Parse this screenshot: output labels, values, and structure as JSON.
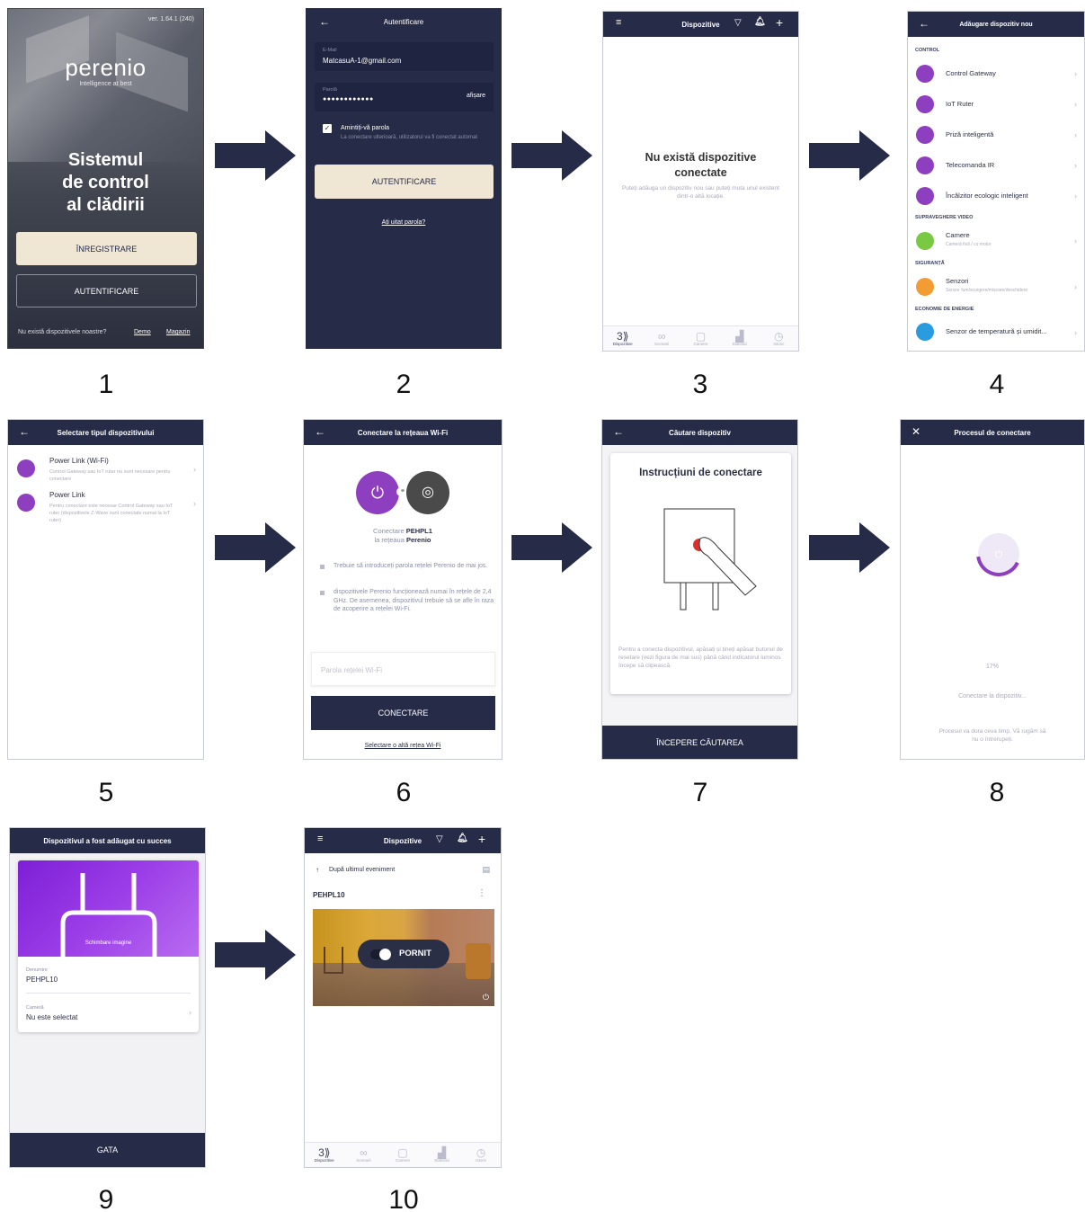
{
  "step_numbers": [
    "1",
    "2",
    "3",
    "4",
    "5",
    "6",
    "7",
    "8",
    "9",
    "10"
  ],
  "colors": {
    "navy": "#262b47",
    "purple": "#8e3fbf",
    "cream": "#efe6d3"
  },
  "s1": {
    "version": "ver. 1.64.1 (240)",
    "logo": "perenio",
    "tagline": "Intelligence at best",
    "headline": [
      "Sistemul",
      "de control",
      "al clădirii"
    ],
    "register": "ÎNREGISTRARE",
    "login": "AUTENTIFICARE",
    "footer_question": "Nu există dispozitivele noastre?",
    "demo": "Demo",
    "shop": "Magazin"
  },
  "s2": {
    "title": "Autentificare",
    "email_label": "E-Mail",
    "email_value": "MatcasuA-1@gmail.com",
    "password_label": "Parolă",
    "password_value": "●●●●●●●●●●●●",
    "show": "afișare",
    "remember": "Amintiți-vă parola",
    "remember_hint": "La conectare ulterioară, utilizatorul va fi conectat automat",
    "login_button": "AUTENTIFICARE",
    "forgot": "Ați uitat parola?"
  },
  "s3": {
    "title": "Dispozitive",
    "empty_title": "Nu există dispozitive conectate",
    "empty_hint": "Puteți adăuga un dispozitiv nou sau puteți muta unul existent dintr-o altă locație."
  },
  "tabs": [
    "Dispozitive",
    "Scenarii",
    "Camere",
    "Statistici",
    "Istoric"
  ],
  "s4": {
    "title": "Adăugare dispozitiv nou",
    "sections": [
      {
        "name": "CONTROL",
        "items": [
          {
            "label": "Control Gateway",
            "sub": ""
          },
          {
            "label": "IoT Ruter",
            "sub": ""
          },
          {
            "label": "Priză inteligentă",
            "sub": ""
          },
          {
            "label": "Telecomanda IR",
            "sub": ""
          },
          {
            "label": "Încălzitor ecologic inteligent",
            "sub": ""
          }
        ]
      },
      {
        "name": "SUPRAVEGHERE VIDEO",
        "items": [
          {
            "label": "Camere",
            "sub": "Cameră fixă / cu motor"
          }
        ]
      },
      {
        "name": "SIGURANȚĂ",
        "items": [
          {
            "label": "Senzori",
            "sub": "Senzor fum/scurgere/mișcare/deschidere"
          }
        ]
      },
      {
        "name": "ECONOMIE DE ENERGIE",
        "items": [
          {
            "label": "Senzor de temperatură și umidit...",
            "sub": ""
          }
        ]
      }
    ]
  },
  "s5": {
    "title": "Selectare tipul dispozitivului",
    "items": [
      {
        "label": "Power Link (Wi-Fi)",
        "sub": "Control Gateway sau IoT ruter nu sunt necesare pentru conectare"
      },
      {
        "label": "Power Link",
        "sub": "Pentru conectare este necesar Control Gateway sau IoT ruter (dispozitivele Z-Wave sunt conectate numai la IoT ruter)"
      }
    ]
  },
  "s6": {
    "title": "Conectare la rețeaua Wi-Fi",
    "connect_prefix": "Conectare",
    "device": "PEHPL1",
    "network_prefix": "la rețeaua",
    "network": "Perenio",
    "bullets": [
      "Trebuie să introduceți parola rețelei Perenio de mai jos.",
      "dispozitivele Perenio funcționează numai în rețele de 2,4 GHz. De asemenea, dispozitivul trebuie să se afle în raza de acoperire a rețelei Wi-Fi."
    ],
    "password_placeholder": "Parola rețelei Wi-Fi",
    "connect_button": "CONECTARE",
    "other_network": "Selectare o altă rețea Wi-Fi"
  },
  "s7": {
    "title": "Căutare dispozitiv",
    "card_title": "Instrucțiuni de conectare",
    "instructions": "Pentru a conecta dispozitivul, apăsați și țineți apăsat butonul de resetare (vezi figura de mai sus) până când indicatorul luminos începe să clipească.",
    "start_button": "ÎNCEPERE CĂUTAREA"
  },
  "s8": {
    "title": "Procesul de conectare",
    "percent": "17%",
    "progress": 0.17,
    "status": "Conectare la dispozitiv...",
    "note": "Procesul va dura ceva timp. Vă rugăm să nu o întrerupeți."
  },
  "s9": {
    "title": "Dispozitivul a fost adăugat cu succes",
    "change_image": "Schimbare imagine",
    "name_label": "Denumire",
    "name_value": "PEHPL10",
    "room_label": "Cameră",
    "room_value": "Nu este selectat",
    "done_button": "GATA"
  },
  "s10": {
    "title": "Dispozitive",
    "sort": "După ultimul eveniment",
    "device": "PEHPL10",
    "toggle": "PORNIT"
  }
}
